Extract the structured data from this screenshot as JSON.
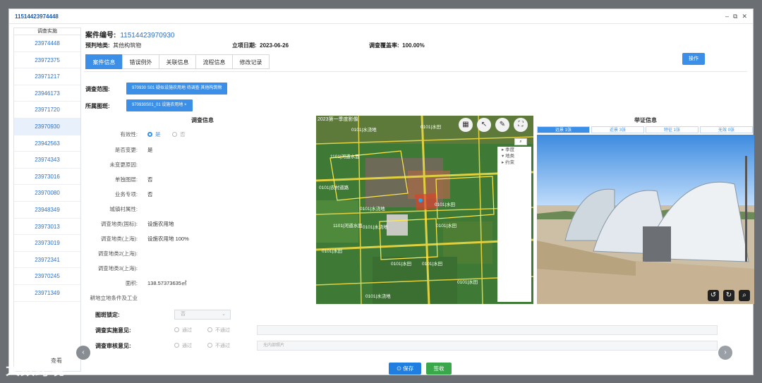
{
  "window": {
    "title": "11514423974448"
  },
  "sidebar": {
    "header": "调查实施",
    "items": [
      "23974448",
      "23972375",
      "23971217",
      "23946173",
      "23971720",
      "23970930",
      "23942563",
      "23974343",
      "23973016",
      "23970080",
      "23948349",
      "23973013",
      "23973019",
      "23972341",
      "23970245",
      "23971349"
    ],
    "active_index": 5,
    "footer": "查看"
  },
  "case": {
    "number_label": "案件编号:",
    "number": "11514423970930",
    "predicted_label": "预判地类:",
    "predicted": "其他构筑物",
    "date_label": "立项日期:",
    "date": "2023-06-26",
    "coverage_label": "调查覆盖率:",
    "coverage": "100.00%"
  },
  "tabs": [
    "案件信息",
    "错误例外",
    "关联信息",
    "流程信息",
    "修改记录"
  ],
  "active_tab": 0,
  "op_button": "操作",
  "scope": {
    "label": "调查范围:",
    "tag": "970930 S01 疑似设施农用地 待调查 其他构筑物"
  },
  "patch": {
    "label": "所属图斑:",
    "tag": "970930S01_01 设施农用地 ×"
  },
  "survey": {
    "title": "调查信息",
    "fields": [
      {
        "k": "有效性:",
        "v": ""
      },
      {
        "k": "是否变更:",
        "v": "是"
      },
      {
        "k": "未变更原因:",
        "v": ""
      },
      {
        "k": "单独图层:",
        "v": "否"
      },
      {
        "k": "业务专项:",
        "v": "否"
      },
      {
        "k": "城镇村属性:",
        "v": ""
      },
      {
        "k": "调查地类(国标):",
        "v": "设施农用地"
      },
      {
        "k": "调查地类(上海):",
        "v": "设施农用地 100%"
      },
      {
        "k": "调查地类2(上海):",
        "v": ""
      },
      {
        "k": "调查地类3(上海):",
        "v": ""
      },
      {
        "k": "面积:",
        "v": "138.57373635㎡"
      },
      {
        "k": "耕地立地条件及工业",
        "v": ""
      }
    ],
    "validity_yes": "是",
    "validity_no": "否"
  },
  "map": {
    "title": "2023第一季度影像",
    "tools": [
      "layers-icon",
      "pointer-icon",
      "pen-icon",
      "expand-icon"
    ],
    "search_icon": "search-icon",
    "layers": [
      "▸ 季度",
      "▾ 地类",
      "▸ 约束"
    ],
    "labels": [
      "0101|水浇地",
      "0101|水田",
      "1101|河道水面",
      "0101|农村道路",
      "0101|水浇地",
      "0101|水田",
      "0101|水浇地",
      "0101|水田",
      "1101|河道水面",
      "0101|水田",
      "0101|水田",
      "0101|水田",
      "0101|水浇地",
      "0101|水田"
    ]
  },
  "evidence": {
    "title": "举证信息",
    "tabs": [
      "远景 1张",
      "近景 3张",
      "特征 1张",
      "无效 0张"
    ],
    "active_tab": 0,
    "controls": [
      "rotate-left-icon",
      "rotate-right-icon",
      "zoom-icon"
    ]
  },
  "form": {
    "lock_label": "图斑锁定:",
    "lock_value": "否",
    "impl_label": "调查实施意见:",
    "review_label": "调查审核意见:",
    "pass": "通过",
    "fail": "不通过",
    "review_placeholder": "无内部照片"
  },
  "buttons": {
    "save": "⊙ 保存",
    "sign": "签收"
  },
  "watermark": "大数跨境",
  "colors": {
    "accent": "#3c8fe6",
    "save": "#1f7ee0",
    "sign": "#3aa84a"
  }
}
